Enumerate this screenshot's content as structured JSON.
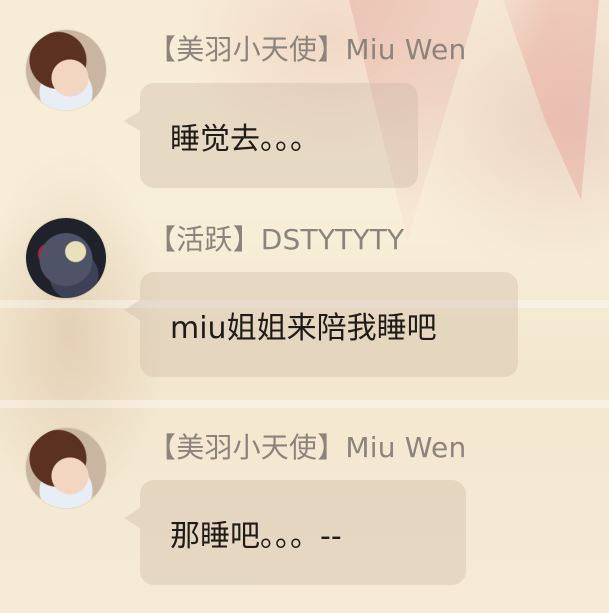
{
  "messages": [
    {
      "sender": "【美羽小天使】Miu Wen",
      "avatar_icon": "anime-girl-avatar",
      "text": "睡觉去。。。"
    },
    {
      "sender": "【活跃】DSTYTYTY",
      "avatar_icon": "cartoon-cat-avatar",
      "text": "miu姐姐来陪我睡吧"
    },
    {
      "sender": "【美羽小天使】Miu Wen",
      "avatar_icon": "anime-girl-avatar",
      "text": "那睡吧。。。--"
    }
  ]
}
